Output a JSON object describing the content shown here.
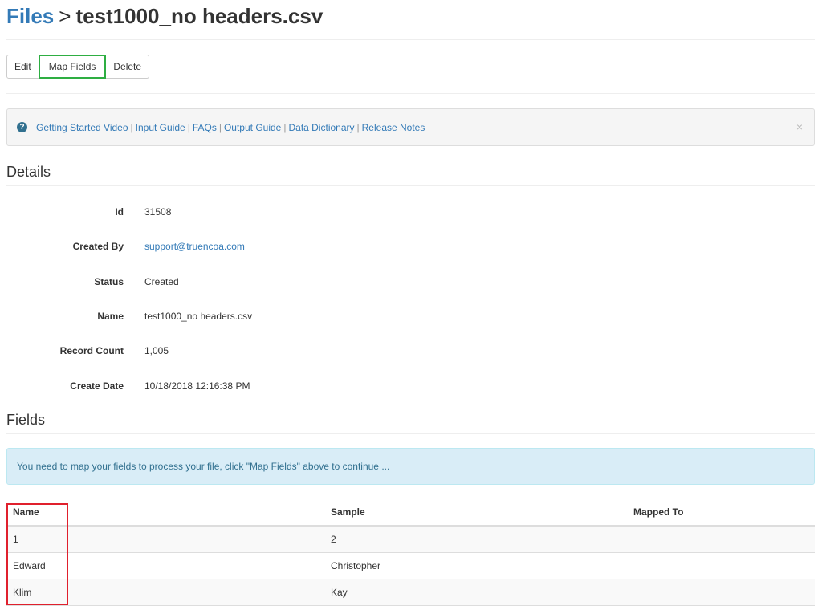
{
  "header": {
    "breadcrumb_link": "Files",
    "separator": ">",
    "file_name": "test1000_no headers.csv"
  },
  "toolbar": {
    "edit_label": "Edit",
    "map_fields_label": "Map Fields",
    "delete_label": "Delete"
  },
  "help_bar": {
    "icon": "question-circle-icon",
    "links": [
      "Getting Started Video",
      "Input Guide",
      "FAQs",
      "Output Guide",
      "Data Dictionary",
      "Release Notes"
    ],
    "separator": "|",
    "close_glyph": "×"
  },
  "details": {
    "title": "Details",
    "rows": [
      {
        "label": "Id",
        "value": "31508"
      },
      {
        "label": "Created By",
        "value": "support@truencoa.com"
      },
      {
        "label": "Status",
        "value": "Created"
      },
      {
        "label": "Name",
        "value": "test1000_no headers.csv"
      },
      {
        "label": "Record Count",
        "value": "1,005"
      },
      {
        "label": "Create Date",
        "value": "10/18/2018 12:16:38 PM"
      }
    ]
  },
  "fields": {
    "title": "Fields",
    "alert": "You need to map your fields to process your file, click \"Map Fields\" above to continue ...",
    "columns": [
      "Name",
      "Sample",
      "Mapped To"
    ],
    "rows": [
      {
        "name": "1",
        "sample": "2",
        "mapped_to": ""
      },
      {
        "name": "Edward",
        "sample": "Christopher",
        "mapped_to": ""
      },
      {
        "name": "Klim",
        "sample": "Kay",
        "mapped_to": ""
      }
    ]
  },
  "colors": {
    "link": "#337ab7",
    "highlight_green": "#2eae42",
    "highlight_red": "#e0202d",
    "alert_bg": "#d9edf7"
  }
}
